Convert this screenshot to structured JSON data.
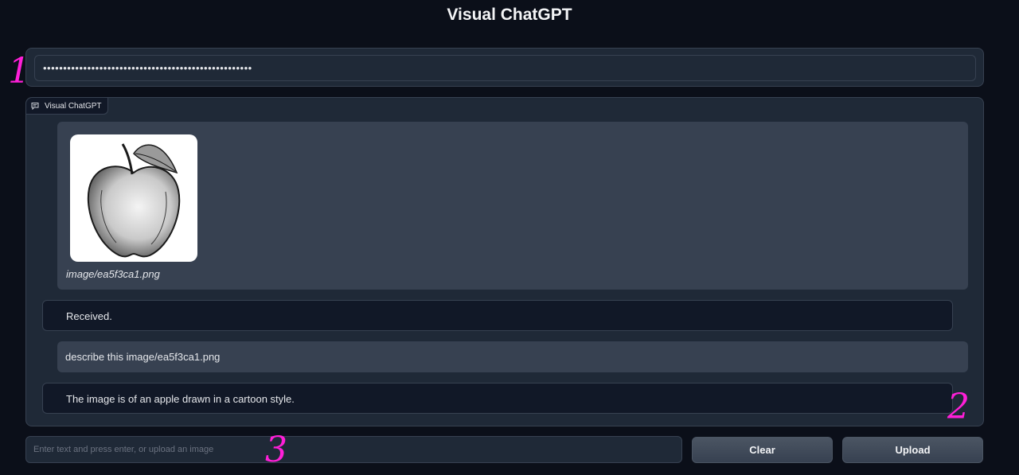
{
  "app": {
    "title": "Visual ChatGPT"
  },
  "api_key": {
    "value": "••••••••••••••••••••••••••••••••••••••••••••••••••••"
  },
  "chatbot": {
    "label": "Visual ChatGPT",
    "messages": [
      {
        "role": "user",
        "type": "image",
        "caption": "image/ea5f3ca1.png",
        "image_subject": "pencil-sketch-apple"
      },
      {
        "role": "bot",
        "text": "Received."
      },
      {
        "role": "user",
        "text": "describe this image/ea5f3ca1.png"
      },
      {
        "role": "bot",
        "text": "The image is of an apple drawn in a cartoon style."
      }
    ]
  },
  "composer": {
    "placeholder": "Enter text and press enter, or upload an image"
  },
  "buttons": {
    "clear": "Clear",
    "upload": "Upload"
  },
  "annotations": [
    "1",
    "2",
    "3"
  ],
  "colors": {
    "annotation": "#ff1fd8",
    "background": "#0b0f19",
    "panel": "#1f2937"
  }
}
